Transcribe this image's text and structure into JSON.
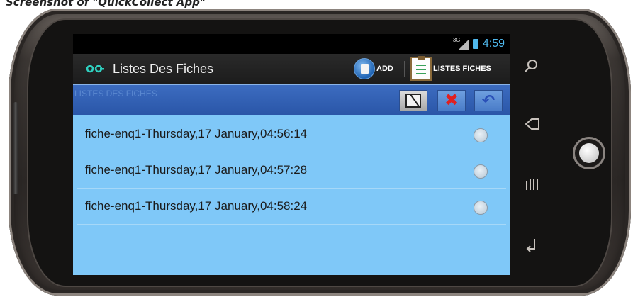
{
  "caption": "Screenshot of \"QuickCollect App\"",
  "statusbar": {
    "network_label": "3G",
    "time": "4:59"
  },
  "actionbar": {
    "title": "Listes Des Fiches",
    "add_label": "ADD",
    "listes_label": "LISTES FICHES"
  },
  "list_header": {
    "title": "LISTES DES FICHES"
  },
  "fiches": [
    {
      "label": "fiche-enq1-Thursday,17 January,04:56:14",
      "selected": false
    },
    {
      "label": "fiche-enq1-Thursday,17 January,04:57:28",
      "selected": false
    },
    {
      "label": "fiche-enq1-Thursday,17 January,04:58:24",
      "selected": false
    }
  ],
  "hardware_buttons": [
    "search-icon",
    "back-icon",
    "menu-icon",
    "home-icon"
  ],
  "colors": {
    "screen_bg": "#7fc8f8",
    "header_bg": "#2a56a8",
    "accent": "#4fb9ee"
  }
}
